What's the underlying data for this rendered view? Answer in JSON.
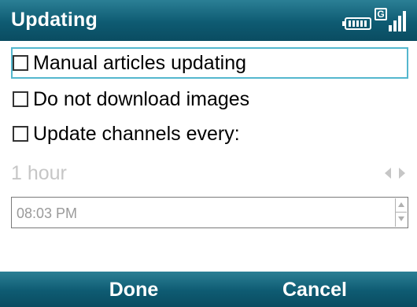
{
  "titlebar": {
    "title": "Updating",
    "network_badge": "G",
    "icons": [
      "battery-icon",
      "network-g-icon",
      "signal-strength-icon"
    ]
  },
  "options": [
    {
      "label": "Manual articles updating",
      "checked": false
    },
    {
      "label": "Do not download images",
      "checked": false
    },
    {
      "label": "Update channels every:",
      "checked": false
    }
  ],
  "interval": {
    "value": "1 hour",
    "disabled": true
  },
  "time": {
    "value": "08:03 PM"
  },
  "softkeys": {
    "left": "Done",
    "right": "Cancel"
  },
  "colors": {
    "bar": "#0e5b72",
    "focus": "#54b7ce",
    "disabled_text": "#c6c6c6"
  }
}
